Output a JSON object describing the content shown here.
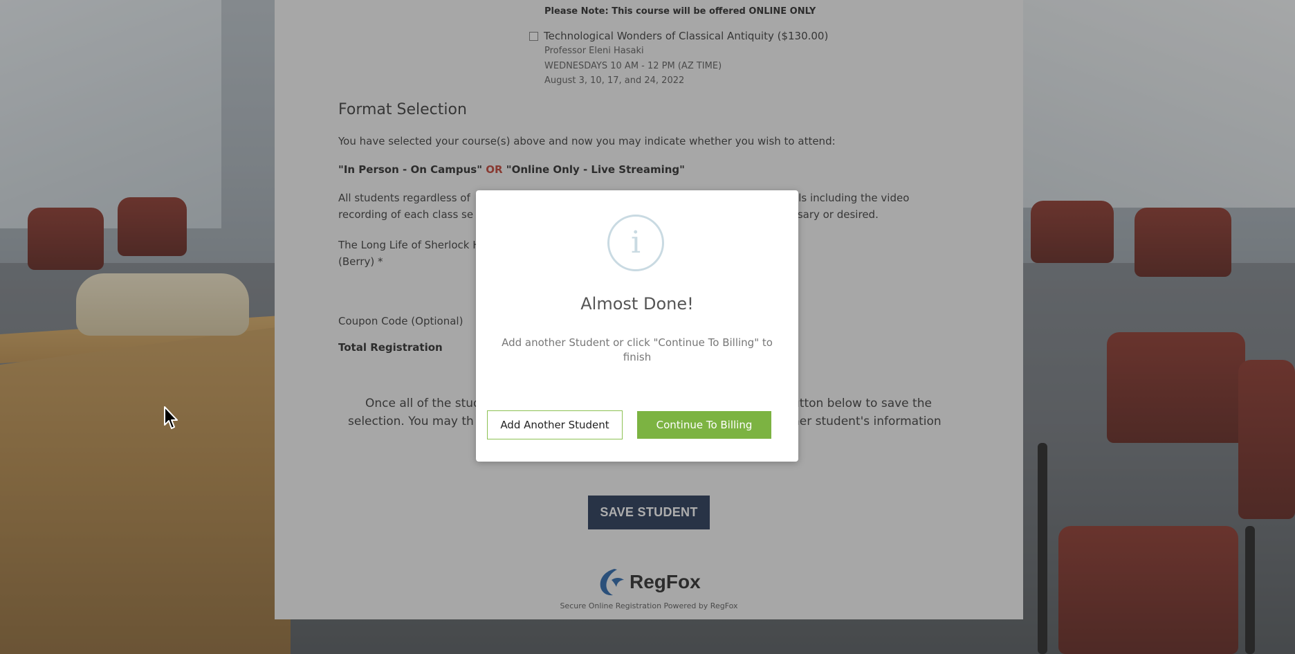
{
  "page": {
    "note": "Please Note: This course will be offered ONLINE ONLY",
    "course": {
      "title": "Technological Wonders of Classical Antiquity ($130.00)",
      "professor": "Professor Eleni Hasaki",
      "schedule": "WEDNESDAYS 10 AM - 12 PM (AZ TIME)",
      "dates": "August 3, 10, 17, and 24, 2022"
    },
    "format_heading": "Format Selection",
    "intro": "You have selected your course(s) above and now you may indicate whether you wish to attend:",
    "option_a": "\"In Person - On Campus\"",
    "or_word": "OR",
    "option_b": "\"Online Only - Live Streaming\"",
    "materials_line1_left": "All students regardless of",
    "materials_line1_right": "als including the video",
    "materials_line2_left": "recording of each class se",
    "materials_line2_right": "ssary or desired.",
    "sherlock_line1": "The Long Life of Sherlock H",
    "sherlock_line2": "(Berry) *",
    "coupon_label": "Coupon Code (Optional)",
    "total_label": "Total Registration",
    "bottom_line1_left": "Once all of the stud",
    "bottom_line1_right": "utton below to save the",
    "bottom_line2_left": "selection. You may th",
    "bottom_line2_right": "her student's information",
    "save_button": "SAVE STUDENT",
    "logo_name": "RegFox",
    "footer": "Secure Online Registration Powered by RegFox"
  },
  "modal": {
    "icon": "info-icon",
    "icon_glyph": "i",
    "title": "Almost Done!",
    "message": "Add another Student or click \"Continue To Billing\" to finish",
    "add_button": "Add Another Student",
    "continue_button": "Continue To Billing"
  },
  "colors": {
    "save_button": "#1b2d4f",
    "continue_button": "#7cb342",
    "add_button_border": "#8cc152",
    "info_icon": "#c9dae2",
    "or_text": "#c0392b"
  }
}
